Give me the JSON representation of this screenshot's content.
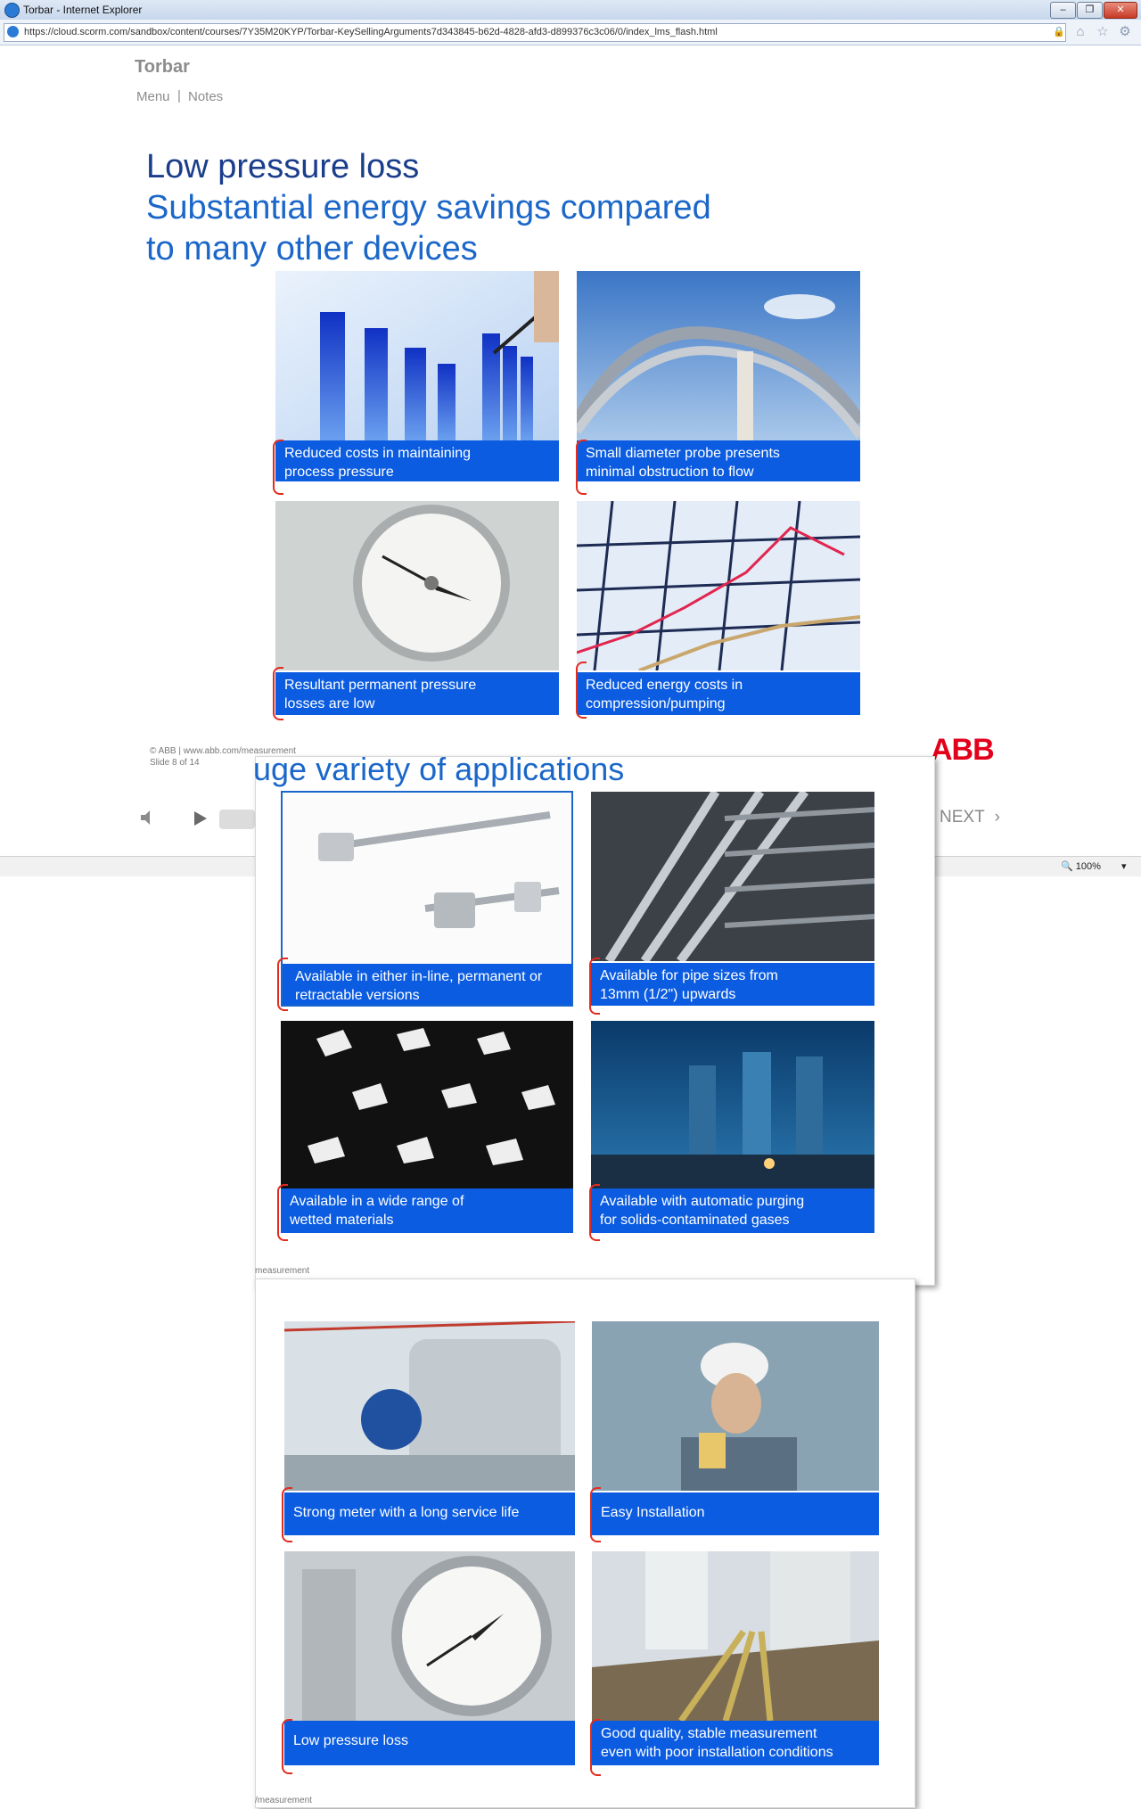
{
  "window": {
    "title": "Torbar - Internet Explorer",
    "minimize": "–",
    "maximize": "❐",
    "close": "✕"
  },
  "address": {
    "url": "https://cloud.scorm.com/sandbox/content/courses/7Y35M20KYP/Torbar-KeySellingArguments7d343845-b62d-4828-afd3-d899376c3c06/0/index_lms_flash.html"
  },
  "app": {
    "title": "Torbar",
    "menu": "Menu",
    "separator": "|",
    "notes": "Notes"
  },
  "slide1": {
    "title_lines": [
      "Low pressure loss",
      "Substantial energy savings compared",
      "to many other devices"
    ],
    "tiles": [
      {
        "line1": "Reduced costs in maintaining",
        "line2": "process pressure"
      },
      {
        "line1": "Small diameter probe presents",
        "line2": "minimal obstruction to flow"
      },
      {
        "line1": "Resultant permanent pressure",
        "line2": "losses are low"
      },
      {
        "line1": "Reduced energy costs in",
        "line2": "compression/pumping"
      }
    ],
    "copyright_line1": "© ABB |  www.abb.com/measurement",
    "copyright_line2": "Slide 8 of 14",
    "logo": "ABB"
  },
  "player": {
    "next_label": "NEXT",
    "next_icon": "›",
    "zoom": "100%"
  },
  "slide2": {
    "title_fragment": "uge variety of applications",
    "tiles": [
      {
        "line1": "Available in either in-line, permanent or",
        "line2": "retractable versions"
      },
      {
        "line1": "Available for pipe sizes from",
        "line2": "13mm (1/2\") upwards"
      },
      {
        "line1": "Available in a wide range of",
        "line2": "wetted materials"
      },
      {
        "line1": "Available with automatic purging",
        "line2": "for solids-contaminated gases"
      }
    ],
    "footer": "measurement"
  },
  "slide3": {
    "tiles": [
      {
        "line1": "Strong meter with a long service life",
        "line2": ""
      },
      {
        "line1": "Easy Installation",
        "line2": ""
      },
      {
        "line1": "Low pressure loss",
        "line2": ""
      },
      {
        "line1": "Good quality, stable measurement",
        "line2": "even with poor installation conditions"
      }
    ],
    "footer": "/measurement"
  }
}
